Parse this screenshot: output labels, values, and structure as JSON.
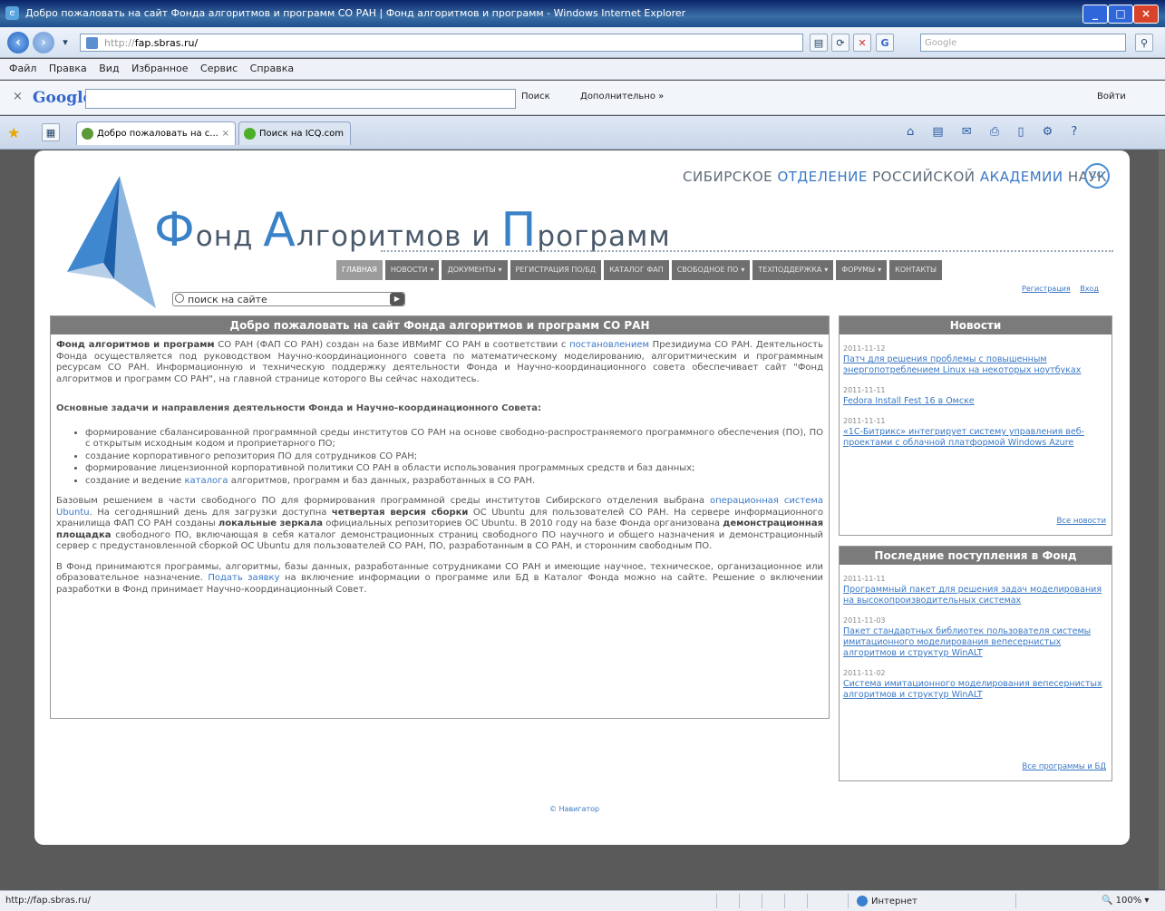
{
  "window": {
    "title": "Добро пожаловать на сайт Фонда алгоритмов и программ СО РАН | Фонд алгоритмов и программ - Windows Internet Explorer"
  },
  "address": {
    "protocol": "http://",
    "host": "fap.sbras.ru/",
    "search_placeholder": "Google"
  },
  "menu": [
    "Файл",
    "Правка",
    "Вид",
    "Избранное",
    "Сервис",
    "Справка"
  ],
  "google_bar": {
    "logo": "Google",
    "search": "Поиск",
    "more": "Дополнительно »",
    "login": "Войти"
  },
  "tabs": [
    {
      "label": "Добро пожаловать на с...",
      "active": true
    },
    {
      "label": "Поиск на ICQ.com",
      "active": false
    }
  ],
  "site": {
    "org_parts": [
      "СИБИРСКОЕ",
      "ОТДЕЛЕНИЕ",
      "РОССИЙСКОЙ",
      "АКАДЕМИИ",
      "НАУК"
    ],
    "logo": {
      "f_big": "Ф",
      "f_rest": "онд ",
      "a_big": "А",
      "a_rest": "лгоритмов и ",
      "p_big": "П",
      "p_rest": "рограмм"
    },
    "nav": [
      {
        "label": "Главная",
        "active": true,
        "caret": false
      },
      {
        "label": "Новости",
        "active": false,
        "caret": true
      },
      {
        "label": "Документы",
        "active": false,
        "caret": true
      },
      {
        "label": "Регистрация ПО/БД",
        "active": false,
        "caret": false
      },
      {
        "label": "Каталог ФАП",
        "active": false,
        "caret": false
      },
      {
        "label": "Свободное ПО",
        "active": false,
        "caret": true
      },
      {
        "label": "Техподдержка",
        "active": false,
        "caret": true
      },
      {
        "label": "Форумы",
        "active": false,
        "caret": true
      },
      {
        "label": "Контакты",
        "active": false,
        "caret": false
      }
    ],
    "search_placeholder": "поиск на сайте",
    "register": "Регистрация",
    "login": "Вход"
  },
  "main": {
    "heading": "Добро пожаловать на сайт Фонда алгоритмов и программ СО РАН",
    "p1_bold": "Фонд алгоритмов и программ",
    "p1_a": " СО РАН (ФАП СО РАН) создан на базе ИВМиМГ СО РАН в соответствии с ",
    "p1_link": "постановлением",
    "p1_b": " Президиума СО РАН. Деятельность Фонда осуществляется под руководством Научно-координационного совета по математическому моделированию, алгоритмическим и программным ресурсам СО РАН. Информационную и техническую поддержку деятельности Фонда и Научно-координационного совета обеспечивает сайт \"Фонд алгоритмов и программ СО РАН\", на главной странице которого Вы сейчас находитесь.",
    "tasks_heading": "Основные задачи и направления деятельности Фонда и Научно-координационного Совета:",
    "tasks": [
      "формирование сбалансированной программной среды институтов СО РАН на основе свободно-распространяемого программного обеспечения (ПО), ПО с открытым исходным кодом и проприетарного ПО;",
      "создание корпоративного репозитория ПО для сотрудников СО РАН;",
      "формирование лицензионной корпоративной политики СО РАН в области использования программных средств и баз данных;"
    ],
    "task4_a": "создание и ведение ",
    "task4_link": "каталога",
    "task4_b": " алгоритмов, программ и баз данных, разработанных в СО РАН.",
    "p3_a": "Базовым решением в части свободного ПО для формирования программной среды институтов Сибирского отделения выбрана ",
    "p3_link": "операционная система Ubuntu",
    "p3_b": ". На сегодняшний день для загрузки доступна ",
    "p3_bold1": "четвертая версия сборки",
    "p3_c": " ОС Ubuntu для пользователей СО РАН. На сервере информационного хранилища ФАП СО РАН созданы ",
    "p3_bold2": "локальные зеркала",
    "p3_d": " официальных репозиториев ОС Ubuntu. В 2010 году на базе Фонда организована ",
    "p3_bold3": "демонстрационная площадка",
    "p3_e": " свободного ПО, включающая в себя каталог демонстрационных страниц свободного ПО научного и общего назначения и демонстрационный сервер с предустановленной сборкой ОС Ubuntu для пользователей СО РАН, ПО, разработанным в СО РАН, и сторонним свободным ПО.",
    "p4_a": "В Фонд принимаются программы, алгоритмы, базы данных, разработанные сотрудниками СО РАН и имеющие научное, техническое, организационное или образовательное назначение. ",
    "p4_link": "Подать заявку",
    "p4_b": " на включение информации о программе или БД в Каталог Фонда можно на сайте. Решение о включении разработки в Фонд принимает Научно-координационный Совет."
  },
  "news": {
    "heading": "Новости",
    "items": [
      {
        "date": "2011-11-12",
        "title": "Патч для решения проблемы с повышенным энергопотреблением Linux на некоторых ноутбуках"
      },
      {
        "date": "2011-11-11",
        "title": "Fedora Install Fest 16 в Омске"
      },
      {
        "date": "2011-11-11",
        "title": "«1С-Битрикс» интегрирует систему управления веб-проектами с облачной платформой Windows Azure"
      }
    ],
    "all": "Все новости"
  },
  "arrivals": {
    "heading": "Последние поступления в Фонд",
    "items": [
      {
        "date": "2011-11-11",
        "title": "Программный пакет для решения задач моделирования на высокопроизводительных системах"
      },
      {
        "date": "2011-11-03",
        "title": "Пакет стандартных библиотек пользователя системы имитационного моделирования вепесернистых алгоритмов и структур WinALT"
      },
      {
        "date": "2011-11-02",
        "title": "Система имитационного моделирования вепесернистых алгоритмов и структур WinALT"
      }
    ],
    "all": "Все программы и БД"
  },
  "footer": "© Навигатор",
  "status": {
    "url": "http://fap.sbras.ru/",
    "zone": "Интернет",
    "zoom": "100%"
  }
}
